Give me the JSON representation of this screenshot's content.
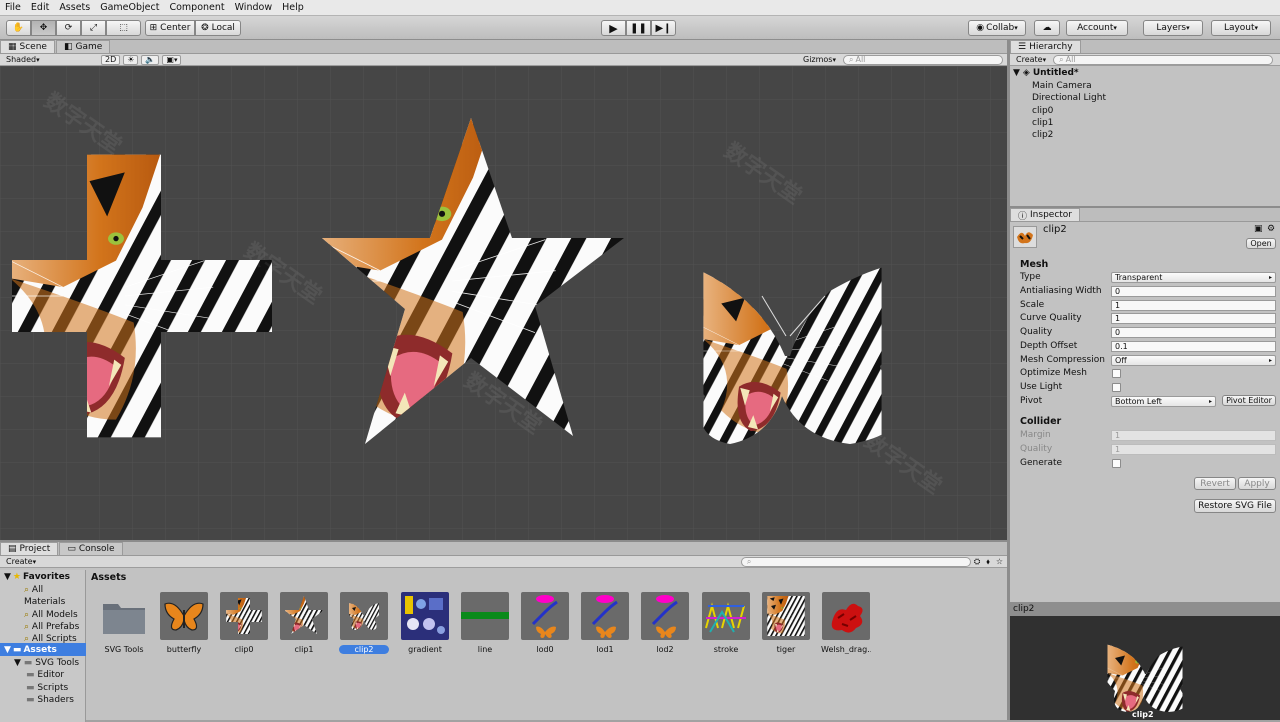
{
  "menu": [
    "File",
    "Edit",
    "Assets",
    "GameObject",
    "Component",
    "Window",
    "Help"
  ],
  "toolbar": {
    "pivot_center": "Center",
    "pivot_local": "Local",
    "collab": "Collab",
    "account": "Account",
    "layers": "Layers",
    "layout": "Layout"
  },
  "scene": {
    "tabs": [
      "Scene",
      "Game"
    ],
    "shading_mode": "Shaded",
    "mode_2d": "2D",
    "gizmos": "Gizmos",
    "search_placeholder": "All",
    "shapes": [
      "plus",
      "star",
      "butterfly"
    ]
  },
  "hierarchy": {
    "title": "Hierarchy",
    "create": "Create",
    "search_placeholder": "All",
    "scene_name": "Untitled*",
    "items": [
      "Main Camera",
      "Directional Light",
      "clip0",
      "clip1",
      "clip2"
    ]
  },
  "inspector": {
    "title": "Inspector",
    "object_name": "clip2",
    "open_button": "Open",
    "mesh_header": "Mesh",
    "mesh": [
      {
        "label": "Type",
        "value": "Transparent",
        "kind": "select"
      },
      {
        "label": "Antialiasing Width",
        "value": "0",
        "kind": "field"
      },
      {
        "label": "Scale",
        "value": "1",
        "kind": "field"
      },
      {
        "label": "Curve Quality",
        "value": "1",
        "kind": "field"
      },
      {
        "label": "Quality",
        "value": "0",
        "kind": "field"
      },
      {
        "label": "Depth Offset",
        "value": "0.1",
        "kind": "field"
      },
      {
        "label": "Mesh Compression",
        "value": "Off",
        "kind": "select"
      },
      {
        "label": "Optimize Mesh",
        "value": false,
        "kind": "check"
      },
      {
        "label": "Use Light",
        "value": false,
        "kind": "check"
      },
      {
        "label": "Pivot",
        "value": "Bottom Left",
        "kind": "select"
      }
    ],
    "pivot_editor": "Pivot Editor",
    "collider_header": "Collider",
    "collider": [
      {
        "label": "Margin",
        "value": "1",
        "kind": "field"
      },
      {
        "label": "Quality",
        "value": "1",
        "kind": "field"
      },
      {
        "label": "Generate",
        "value": false,
        "kind": "check"
      }
    ],
    "revert": "Revert",
    "apply": "Apply",
    "restore": "Restore SVG File"
  },
  "project": {
    "tabs": [
      "Project",
      "Console"
    ],
    "create": "Create",
    "favorites_label": "Favorites",
    "favorites": [
      "All Materials",
      "All Models",
      "All Prefabs",
      "All Scripts"
    ],
    "assets_label": "Assets",
    "tree": [
      "SVG Tools",
      "Editor",
      "Scripts",
      "Shaders"
    ],
    "breadcrumb": "Assets",
    "assets": [
      {
        "name": "SVG Tools",
        "icon": "folder-icon"
      },
      {
        "name": "butterfly",
        "icon": "butterfly-icon"
      },
      {
        "name": "clip0",
        "icon": "tiger-plus-icon"
      },
      {
        "name": "clip1",
        "icon": "tiger-star-icon"
      },
      {
        "name": "clip2",
        "icon": "tiger-butterfly-icon",
        "selected": true
      },
      {
        "name": "gradient",
        "icon": "gradient-icon"
      },
      {
        "name": "line",
        "icon": "line-icon"
      },
      {
        "name": "lod0",
        "icon": "lod-icon"
      },
      {
        "name": "lod1",
        "icon": "lod-icon"
      },
      {
        "name": "lod2",
        "icon": "lod-icon"
      },
      {
        "name": "stroke",
        "icon": "stroke-icon"
      },
      {
        "name": "tiger",
        "icon": "tiger-icon"
      },
      {
        "name": "Welsh_drag...",
        "icon": "dragon-icon"
      }
    ]
  },
  "preview": {
    "title": "clip2",
    "caption": "clip2"
  },
  "colors": {
    "scene_bg": "#464646",
    "selection": "#3e7ee0",
    "tiger_orange": "#d2741b"
  }
}
